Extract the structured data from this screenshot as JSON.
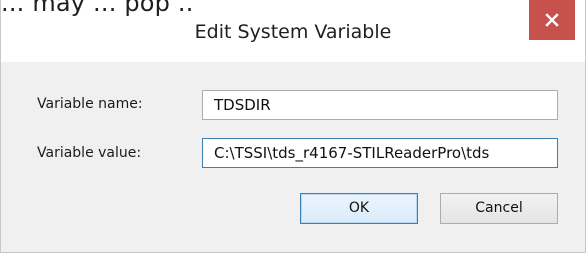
{
  "background_text": "... may ... pop ..",
  "dialog": {
    "title": "Edit System Variable",
    "close_icon": "close-x-icon",
    "close_color": "#c7514c"
  },
  "form": {
    "variable_name_label": "Variable name:",
    "variable_name_value": "TDSDIR",
    "variable_value_label": "Variable value:",
    "variable_value_value": "C:\\TSSI\\tds_r4167-STILReaderPro\\tds"
  },
  "buttons": {
    "ok": "OK",
    "cancel": "Cancel"
  }
}
